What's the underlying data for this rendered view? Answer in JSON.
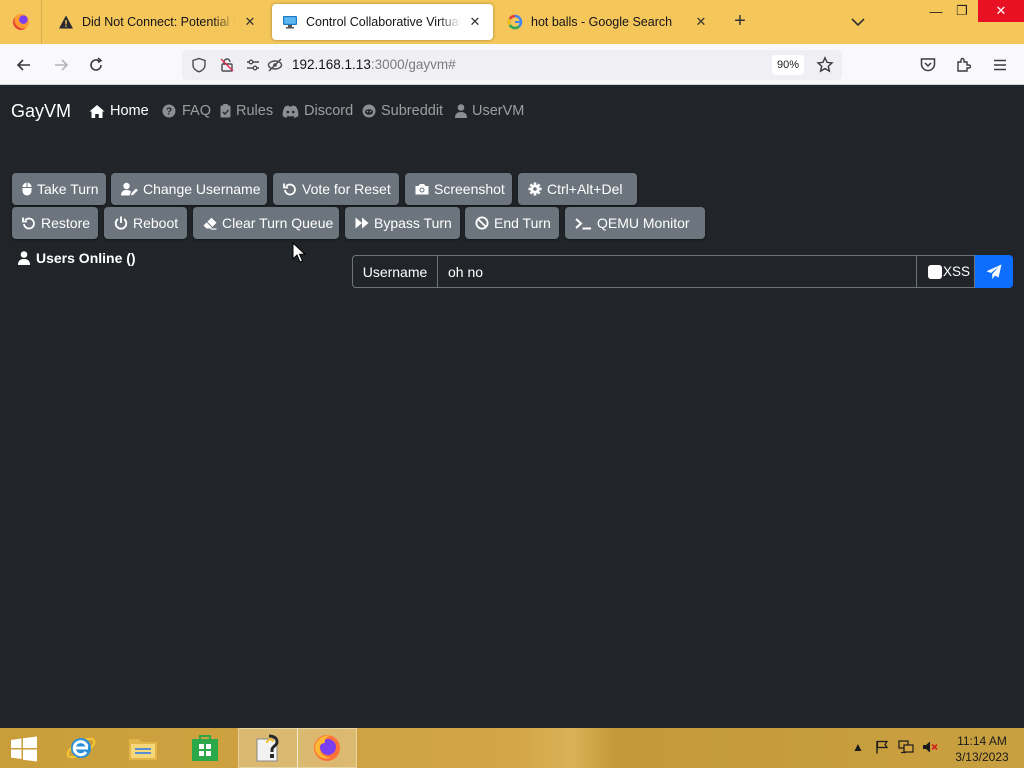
{
  "browser": {
    "tabs": [
      {
        "title": "Did Not Connect: Potential Security Issue",
        "icon": "warning-icon",
        "active": false
      },
      {
        "title": "Control Collaborative Virtual Machines",
        "icon": "monitor-icon",
        "active": true
      },
      {
        "title": "hot balls - Google Search",
        "icon": "google-icon",
        "active": false
      }
    ],
    "url_host": "192.168.1.13",
    "url_path": ":3000/gayvm#",
    "zoom": "90%"
  },
  "site": {
    "brand": "GayVM",
    "nav": [
      {
        "label": "Home",
        "icon": "home-icon",
        "active": true
      },
      {
        "label": "FAQ",
        "icon": "question-circle-icon"
      },
      {
        "label": "Rules",
        "icon": "clipboard-icon"
      },
      {
        "label": "Discord",
        "icon": "discord-icon"
      },
      {
        "label": "Subreddit",
        "icon": "reddit-icon"
      },
      {
        "label": "UserVM",
        "icon": "user-icon"
      }
    ]
  },
  "controls": {
    "row1": [
      {
        "label": "Take Turn",
        "icon": "mouse-icon"
      },
      {
        "label": "Change Username",
        "icon": "user-edit-icon"
      },
      {
        "label": "Vote for Reset",
        "icon": "undo-icon"
      },
      {
        "label": "Screenshot",
        "icon": "camera-icon"
      },
      {
        "label": "Ctrl+Alt+Del",
        "icon": "gear-icon"
      }
    ],
    "row2": [
      {
        "label": "Restore",
        "icon": "undo-icon"
      },
      {
        "label": "Reboot",
        "icon": "power-icon"
      },
      {
        "label": "Clear Turn Queue",
        "icon": "eraser-icon"
      },
      {
        "label": "Bypass Turn",
        "icon": "fast-forward-icon"
      },
      {
        "label": "End Turn",
        "icon": "ban-icon"
      },
      {
        "label": "QEMU Monitor",
        "icon": "terminal-icon"
      }
    ]
  },
  "users_online": {
    "label": "Users Online ()"
  },
  "chat": {
    "username_label": "Username",
    "message_value": "oh no",
    "xss_label": "XSS",
    "send_icon": "paper-plane-icon"
  },
  "taskbar": {
    "time": "11:14 AM",
    "date": "3/13/2023"
  }
}
